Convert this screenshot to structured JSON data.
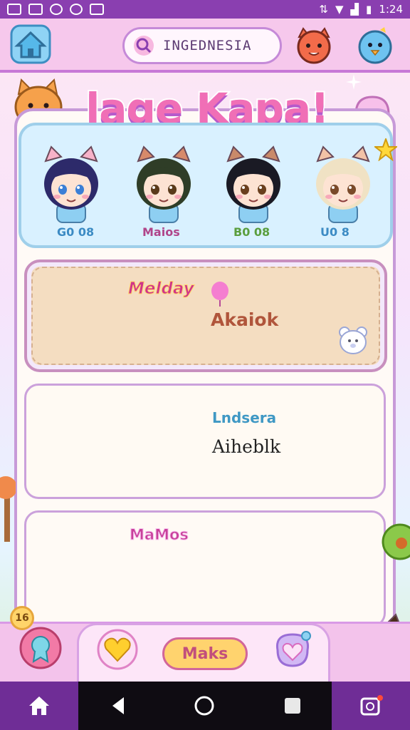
{
  "status_bar": {
    "time": "1:24"
  },
  "header": {
    "search_text": "INGEDNESIA"
  },
  "title": {
    "text": "lage Kapa!"
  },
  "featured_row": {
    "labels": [
      "G0 08",
      "Maios",
      "B0 08",
      "U0 8"
    ]
  },
  "row2": {
    "badge_label": "Melday",
    "text": "Akaiok"
  },
  "row3": {
    "title": "Lndsera",
    "text": "Aiheblk"
  },
  "row4": {
    "badge_label": "MaMos"
  },
  "dock": {
    "counter": "16",
    "center_button": "Maks"
  }
}
